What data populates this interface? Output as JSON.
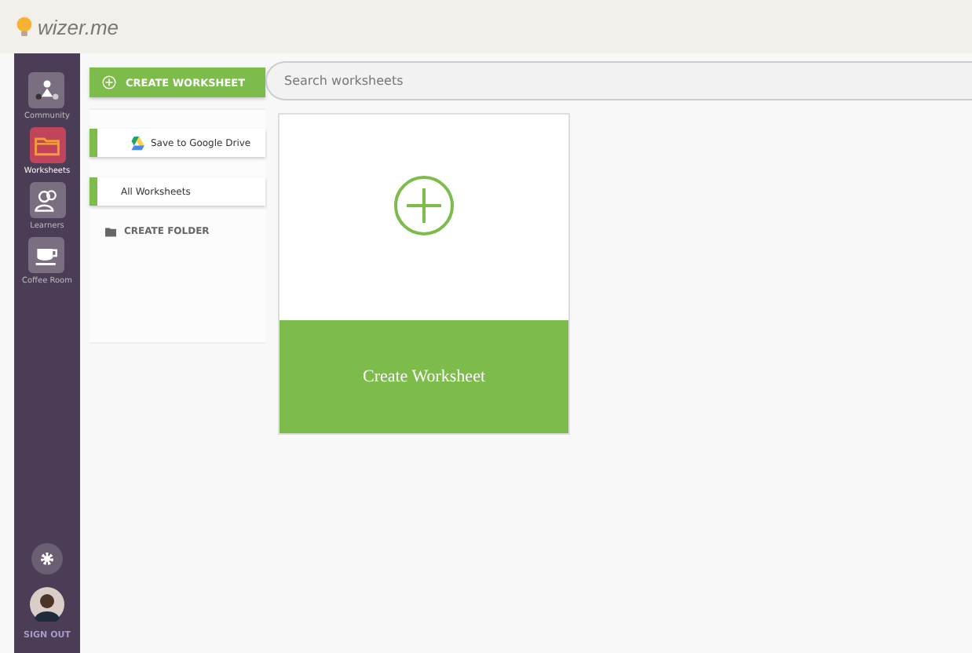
{
  "logo": {
    "text": "wizer.me"
  },
  "nav": [
    {
      "label": "Community",
      "selected": false
    },
    {
      "label": "Worksheets",
      "selected": true
    },
    {
      "label": "Learners",
      "selected": false
    },
    {
      "label": "Coffee Room",
      "selected": false
    }
  ],
  "sign_out": "SIGN OUT",
  "create_button": "CREATE WORKSHEET",
  "panel_items": [
    {
      "label": "Save to Google Drive",
      "kind": "drive"
    },
    {
      "label": "All Worksheets",
      "kind": "plain"
    }
  ],
  "create_folder": "CREATE FOLDER",
  "search": {
    "placeholder": "Search worksheets"
  },
  "card": {
    "label": "Create Worksheet"
  }
}
